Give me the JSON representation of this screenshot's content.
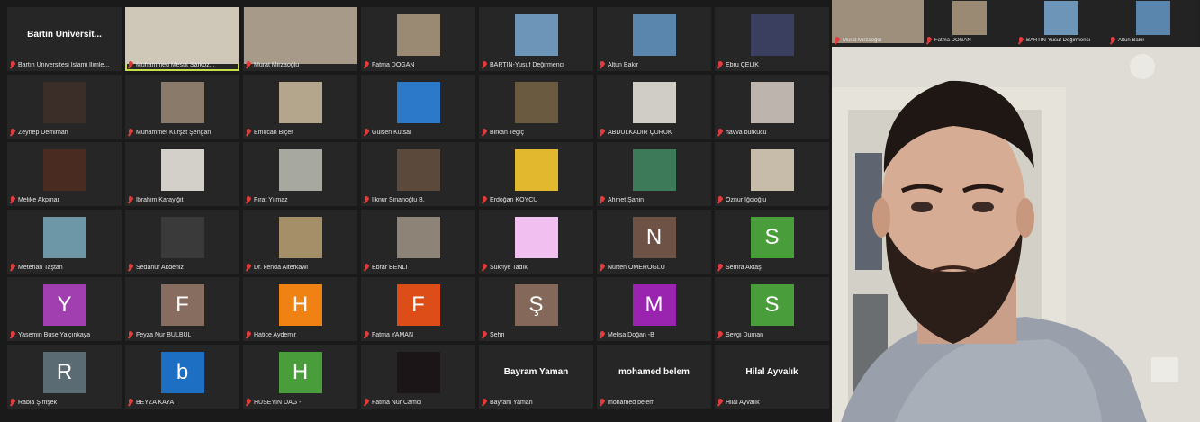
{
  "colors": {
    "grid_bg": "#1a1a1a",
    "tile_bg": "#262626",
    "active_speaker_border": "#c6e04a",
    "muted_icon": "#e23c3c"
  },
  "gallery": [
    {
      "name": "Bartın Üniversitesi İslami İlimle...",
      "big_name": "Bartın Üniversit...",
      "kind": "name"
    },
    {
      "name": "Muhammed Mesut Sarkoz...",
      "kind": "video",
      "thumb": "#cfc8b8",
      "active": true
    },
    {
      "name": "Murat Mirzaoğlu",
      "kind": "video",
      "thumb": "#a89a88"
    },
    {
      "name": "Fatma DOĞAN",
      "kind": "photo",
      "thumb": "#9a8a74"
    },
    {
      "name": "BARTIN-Yusuf Değirmenci",
      "kind": "photo",
      "thumb": "#6d95b8"
    },
    {
      "name": "Altun Bakır",
      "kind": "photo",
      "thumb": "#5a86ad"
    },
    {
      "name": "Ebru ÇELİK",
      "kind": "photo",
      "thumb": "#3a3f60"
    },
    {
      "name": "Zeynep Demirhan",
      "kind": "photo",
      "thumb": "#3b2e28"
    },
    {
      "name": "Muhammet Kürşat Şengan",
      "kind": "photo",
      "thumb": "#8a7a6a"
    },
    {
      "name": "Emircan Biçer",
      "kind": "photo",
      "thumb": "#b3a68c"
    },
    {
      "name": "Gülşen Kutsal",
      "kind": "photo",
      "thumb": "#2d79c9"
    },
    {
      "name": "Birkan Teğiç",
      "kind": "photo",
      "thumb": "#6a5a40"
    },
    {
      "name": "ABDULKADİR ÇÜRÜK",
      "kind": "photo",
      "thumb": "#d0ccc6"
    },
    {
      "name": "havva burkucu",
      "kind": "photo",
      "thumb": "#bdb5ad"
    },
    {
      "name": "Melike Akpınar",
      "kind": "photo",
      "thumb": "#4a2b22"
    },
    {
      "name": "İbrahim Karayiğit",
      "kind": "photo",
      "thumb": "#d3d0c9"
    },
    {
      "name": "Fırat Yılmaz",
      "kind": "photo",
      "thumb": "#a7a9a1"
    },
    {
      "name": "İlknur Sinanoğlu B.",
      "kind": "photo",
      "thumb": "#5b4a3c"
    },
    {
      "name": "Erdoğan KÖYCÜ",
      "kind": "photo",
      "thumb": "#e2b82e"
    },
    {
      "name": "Ahmet Şahin",
      "kind": "photo",
      "thumb": "#3d7a5a"
    },
    {
      "name": "Öznur İğcioğlu",
      "kind": "photo",
      "thumb": "#c7bba9"
    },
    {
      "name": "Metehan Taştan",
      "kind": "photo",
      "thumb": "#6d97a6"
    },
    {
      "name": "Sedanur Akdeniz",
      "kind": "photo",
      "thumb": "#3a3a3a"
    },
    {
      "name": "Dr. kenda Alterkawi",
      "kind": "photo",
      "thumb": "#a58f69"
    },
    {
      "name": "Ebrar BENLİ",
      "kind": "photo",
      "thumb": "#8d8377"
    },
    {
      "name": "Şükriye Tadık",
      "kind": "photo",
      "thumb": "#f1bff0"
    },
    {
      "name": "Nurten ÖMEROĞLU",
      "kind": "initial",
      "initial": "N",
      "thumb": "#6e5246"
    },
    {
      "name": "Semra Aktaş",
      "kind": "initial",
      "initial": "S",
      "thumb": "#4a9d3b"
    },
    {
      "name": "Yasemin Buse Yalçınkaya",
      "kind": "initial",
      "initial": "Y",
      "thumb": "#a23fb0"
    },
    {
      "name": "Feyza Nur BÜLBÜL",
      "kind": "initial",
      "initial": "F",
      "thumb": "#876c60"
    },
    {
      "name": "Hatice Aydemir",
      "kind": "initial",
      "initial": "H",
      "thumb": "#f08214"
    },
    {
      "name": "Fatma YAMAN",
      "kind": "initial",
      "initial": "F",
      "thumb": "#dc4d17"
    },
    {
      "name": "Şehri",
      "kind": "initial",
      "initial": "Ş",
      "thumb": "#846859"
    },
    {
      "name": "Melisa Doğan -B",
      "kind": "initial",
      "initial": "M",
      "thumb": "#9a24b0"
    },
    {
      "name": "Sevgi Duman",
      "kind": "initial",
      "initial": "S",
      "thumb": "#4a9d3b"
    },
    {
      "name": "Rabia Şimşek",
      "kind": "initial",
      "initial": "R",
      "thumb": "#5a6b74"
    },
    {
      "name": "BEYZA KAYA",
      "kind": "initial",
      "initial": "b",
      "thumb": "#1d6fc4"
    },
    {
      "name": "HÜSEYİN DAĞ -",
      "kind": "initial",
      "initial": "H",
      "thumb": "#4a9d3b"
    },
    {
      "name": "Fatma Nur Camcı",
      "kind": "photo",
      "thumb": "#1c1517"
    },
    {
      "name": "Bayram Yaman",
      "big_name": "Bayram Yaman",
      "kind": "name"
    },
    {
      "name": "mohamed belem",
      "big_name": "mohamed belem",
      "kind": "name"
    },
    {
      "name": "Hilal Ayvalık",
      "big_name": "Hilal Ayvalık",
      "kind": "name"
    }
  ],
  "strip": [
    {
      "name": "Murat Mirzaoğlu",
      "thumb": "#9e8f7d",
      "big": true
    },
    {
      "name": "Fatma DOĞAN",
      "thumb": "#9a8a74"
    },
    {
      "name": "BARTIN-Yusuf Değirmenci",
      "thumb": "#6d95b8"
    },
    {
      "name": "Altun Bakır",
      "thumb": "#5a86ad"
    }
  ]
}
